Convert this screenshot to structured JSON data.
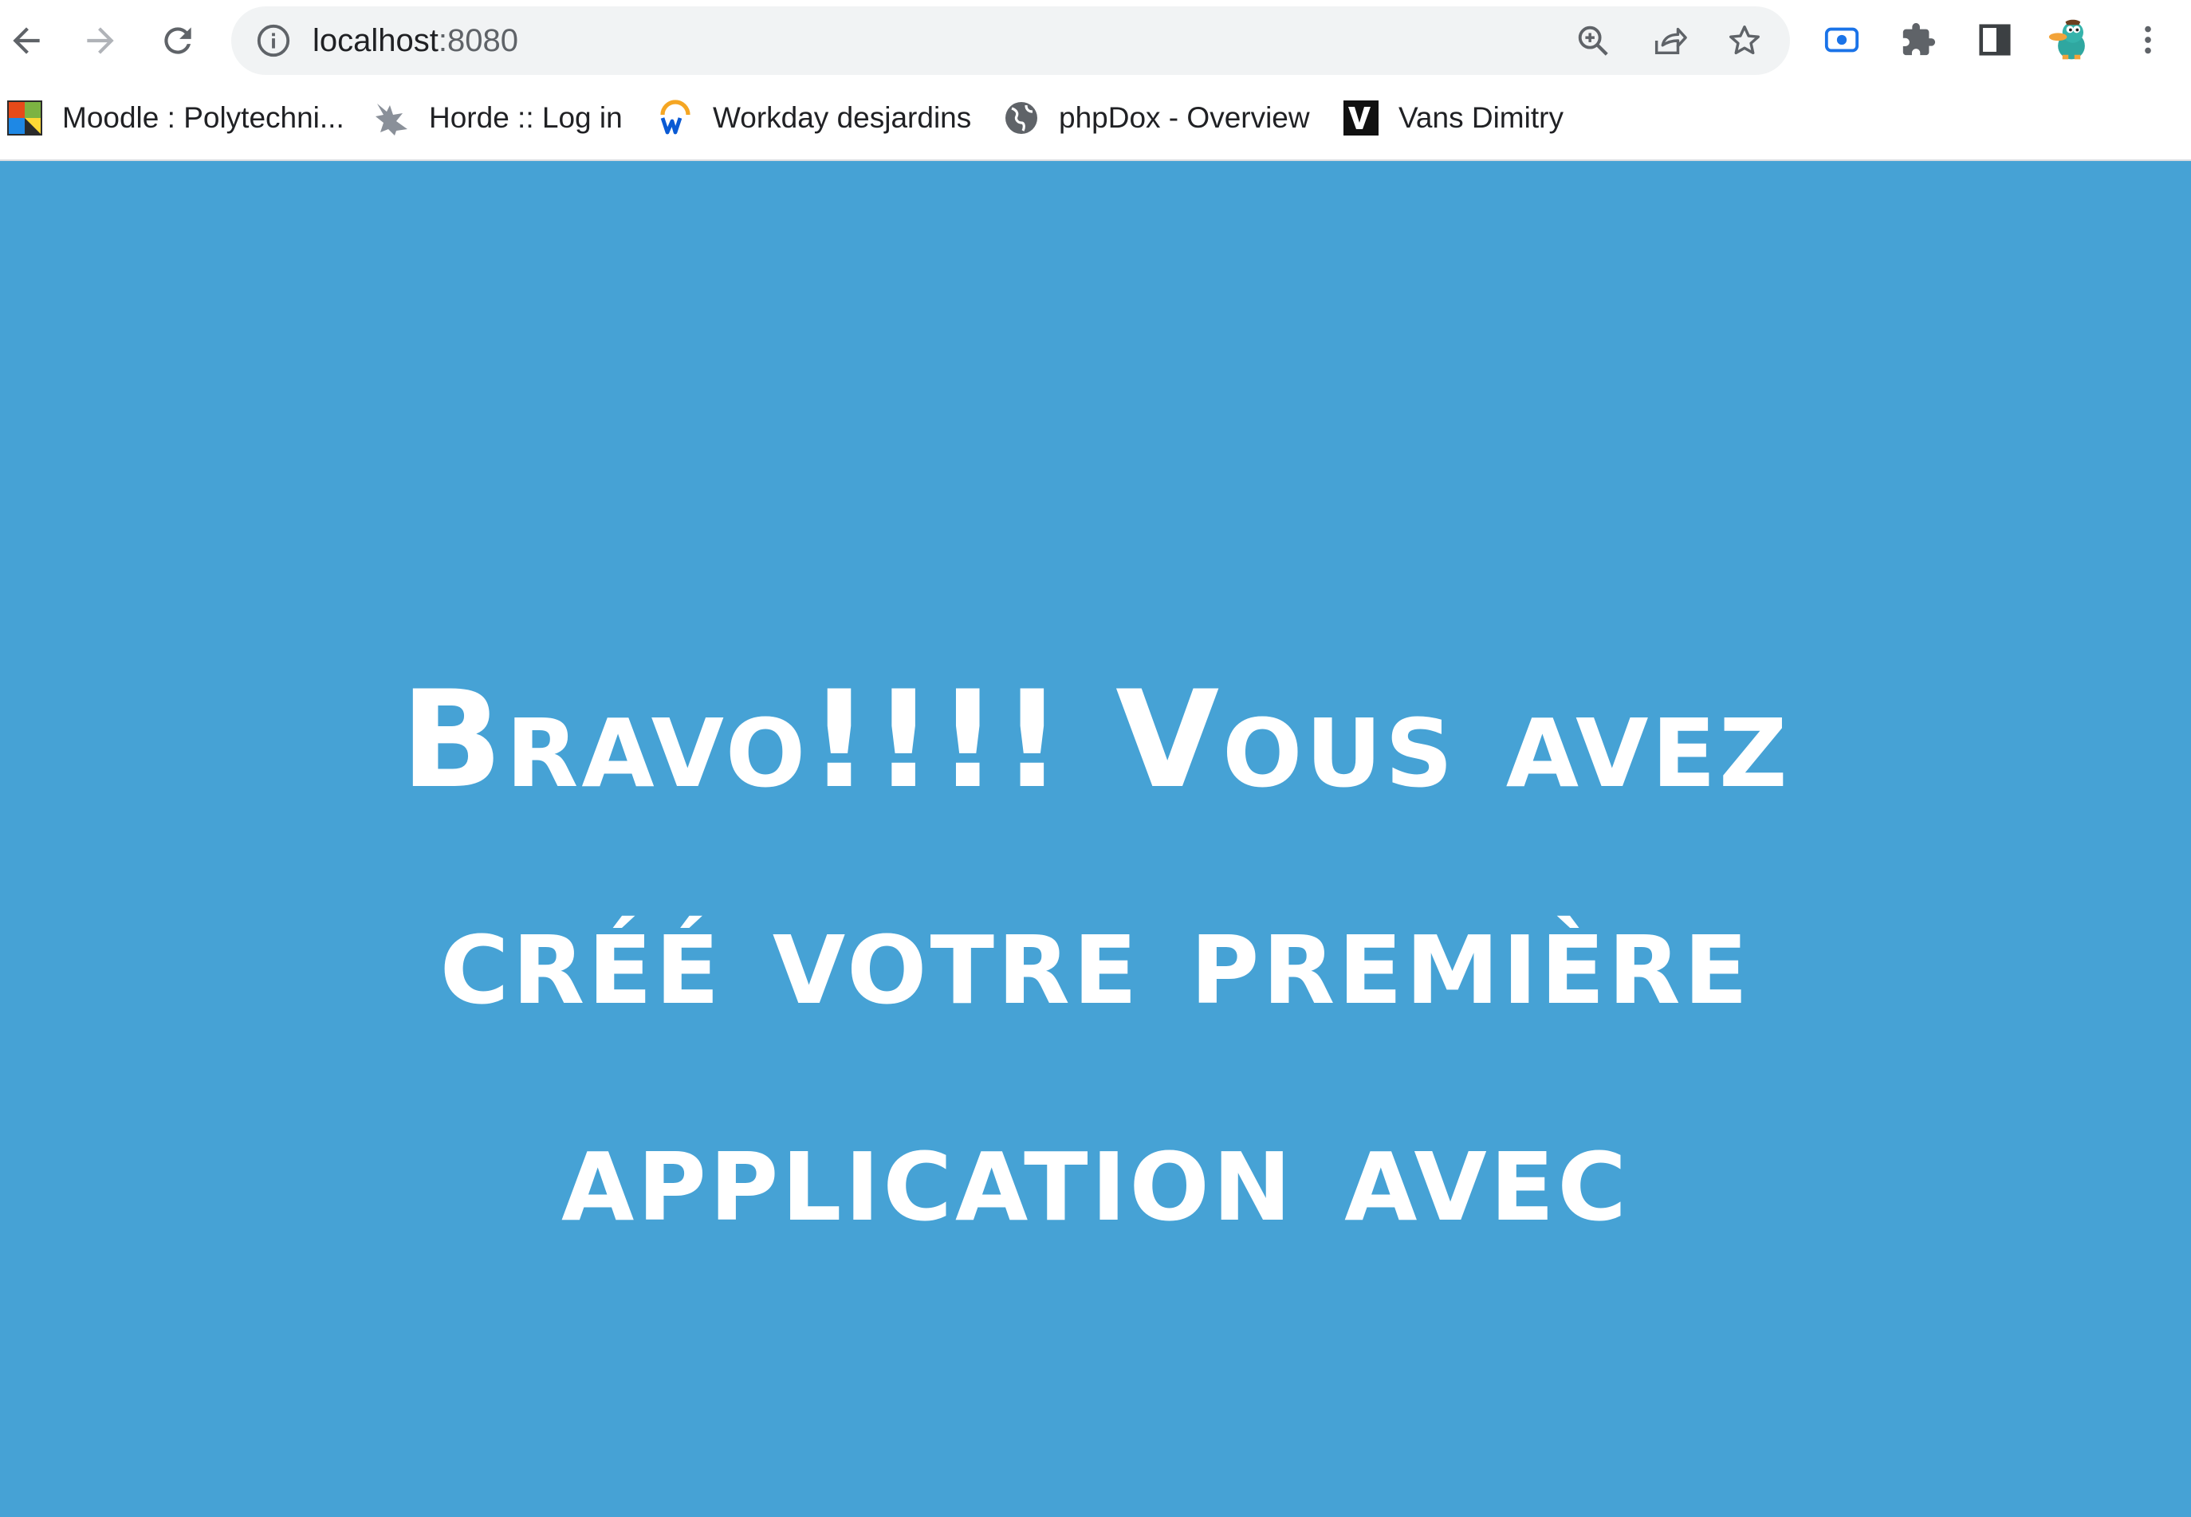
{
  "browser": {
    "url_host": "localhost",
    "url_port": ":8080",
    "bookmarks": [
      {
        "label": "Moodle : Polytechni...",
        "icon": "moodle-icon"
      },
      {
        "label": "Horde :: Log in",
        "icon": "horde-icon"
      },
      {
        "label": "Workday desjardins",
        "icon": "workday-icon"
      },
      {
        "label": "phpDox - Overview",
        "icon": "globe-icon"
      },
      {
        "label": "Vans Dimitry",
        "icon": "vans-icon"
      }
    ]
  },
  "page": {
    "headline": "Bravo!!!! Vous avez créé votre première application avec",
    "background_color": "#46a2d5",
    "text_color": "#ffffff"
  }
}
